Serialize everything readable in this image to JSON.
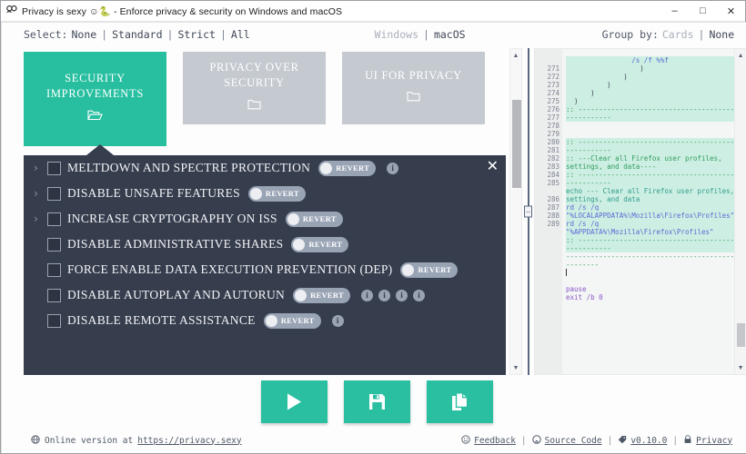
{
  "window": {
    "icon": "app-logo",
    "title": "Privacy is sexy ☺︎🐍 - Enforce privacy & security on Windows and macOS",
    "minimize": "–",
    "maximize": "□",
    "close": "✕"
  },
  "selector": {
    "select_label": "Select:",
    "options": [
      {
        "label": "None",
        "active": false
      },
      {
        "label": "Standard",
        "active": false
      },
      {
        "label": "Strict",
        "active": false
      },
      {
        "label": "All",
        "active": false
      }
    ],
    "os_options": [
      {
        "label": "Windows",
        "active": true
      },
      {
        "label": "macOS",
        "active": false
      }
    ],
    "group_label": "Group by:",
    "group_options": [
      {
        "label": "Cards",
        "active": true
      },
      {
        "label": "None",
        "active": false
      }
    ],
    "separator": "|"
  },
  "cards": [
    {
      "title": "SECURITY IMPROVEMENTS",
      "folder_icon": "open-folder-icon",
      "folder_glyph": "🗁",
      "selected": true
    },
    {
      "title": "PRIVACY OVER SECURITY",
      "folder_icon": "closed-folder-icon",
      "folder_glyph": "🗀",
      "selected": false
    },
    {
      "title": "UI FOR PRIVACY",
      "folder_icon": "closed-folder-icon",
      "folder_glyph": "🗀",
      "selected": false
    }
  ],
  "list_panel": {
    "close_glyph": "✕",
    "chevron_glyph": "›",
    "revert_label": "REVERT",
    "info_glyph": "i",
    "rows": [
      {
        "label": "MELTDOWN AND SPECTRE PROTECTION",
        "expandable": true,
        "checked": false,
        "revert": true,
        "info_count": 1
      },
      {
        "label": "DISABLE UNSAFE FEATURES",
        "expandable": true,
        "checked": false,
        "revert": true,
        "info_count": 0
      },
      {
        "label": "INCREASE CRYPTOGRAPHY ON ISS",
        "expandable": true,
        "checked": false,
        "revert": true,
        "info_count": 0
      },
      {
        "label": "DISABLE ADMINISTRATIVE SHARES",
        "expandable": false,
        "checked": false,
        "revert": true,
        "info_count": 0
      },
      {
        "label": "FORCE ENABLE DATA EXECUTION PREVENTION (DEP)",
        "expandable": false,
        "checked": false,
        "revert": true,
        "info_count": 0
      },
      {
        "label": "DISABLE AUTOPLAY AND AUTORUN",
        "expandable": false,
        "checked": false,
        "revert": true,
        "info_count": 4
      },
      {
        "label": "DISABLE REMOTE ASSISTANCE",
        "expandable": false,
        "checked": false,
        "revert": true,
        "info_count": 1
      }
    ]
  },
  "code": {
    "first_partial_line": "                /s /f %%f",
    "lines": [
      {
        "num": "271",
        "text": "                  )",
        "hl": true,
        "tok": "dark"
      },
      {
        "num": "272",
        "text": "              )",
        "hl": true,
        "tok": "dark"
      },
      {
        "num": "273",
        "text": "          )",
        "hl": true,
        "tok": "dark"
      },
      {
        "num": "274",
        "text": "      )",
        "hl": true,
        "tok": "dark"
      },
      {
        "num": "275",
        "text": "  )",
        "hl": true,
        "tok": "dark"
      },
      {
        "num": "276",
        "text": ":: -------------------------------------------------",
        "hl": true,
        "tok": "green"
      },
      {
        "num": "277",
        "text": "",
        "hl": false,
        "tok": "dark"
      },
      {
        "num": "278",
        "text": "",
        "hl": false,
        "tok": "dark"
      },
      {
        "num": "279",
        "text": ":: -------------------------------------------------",
        "hl": true,
        "tok": "green"
      },
      {
        "num": "280",
        "text": ":: ---Clear all Firefox user profiles, settings, and data----",
        "hl": true,
        "tok": "green"
      },
      {
        "num": "281",
        "text": ":: -------------------------------------------------",
        "hl": true,
        "tok": "green"
      },
      {
        "num": "282",
        "text": "echo --- Clear all Firefox user profiles, settings, and data",
        "hl": true,
        "tok": "teal"
      },
      {
        "num": "283",
        "text": "rd /s /q \"%LOCALAPPDATA%\\Mozilla\\Firefox\\Profiles\"",
        "hl": true,
        "tok": "blue"
      },
      {
        "num": "284",
        "text": "rd /s /q \"%APPDATA%\\Mozilla\\Firefox\\Profiles\"",
        "hl": true,
        "tok": "blue"
      },
      {
        "num": "285",
        "text": ":: -------------------------------------------------",
        "hl": true,
        "tok": "green"
      },
      {
        "num": "",
        "text": "-------------------------------------------------",
        "hl": false,
        "tok": "green"
      },
      {
        "num": "286",
        "text": "",
        "hl": false,
        "tok": "dark",
        "caret": true
      },
      {
        "num": "287",
        "text": "",
        "hl": false,
        "tok": "dark"
      },
      {
        "num": "288",
        "text": "pause",
        "hl": false,
        "tok": "purple"
      },
      {
        "num": "289",
        "text": "exit /b 0",
        "hl": false,
        "tok": "purple"
      }
    ]
  },
  "actions": [
    {
      "name": "run-button",
      "icon": "play-icon",
      "label": "Run"
    },
    {
      "name": "save-button",
      "icon": "floppy-icon",
      "label": "Save"
    },
    {
      "name": "copy-button",
      "icon": "copy-icon",
      "label": "Copy"
    }
  ],
  "footer": {
    "online_icon": "globe-icon",
    "online_text": "Online version at",
    "online_link": "https://privacy.sexy",
    "separator": "|",
    "links": [
      {
        "icon": "smiley-icon",
        "glyph": "☺",
        "label": "Feedback"
      },
      {
        "icon": "github-icon",
        "glyph": "●",
        "label": "Source Code"
      },
      {
        "icon": "tag-icon",
        "glyph": "⚑",
        "label": "v0.10.0"
      },
      {
        "icon": "lock-icon",
        "glyph": "⚿",
        "label": "Privacy"
      }
    ]
  },
  "colors": {
    "accent": "#2bbfa1",
    "panel_dark": "#363d4d",
    "card_inactive": "#c5cad1",
    "code_highlight": "#cdeee2"
  }
}
